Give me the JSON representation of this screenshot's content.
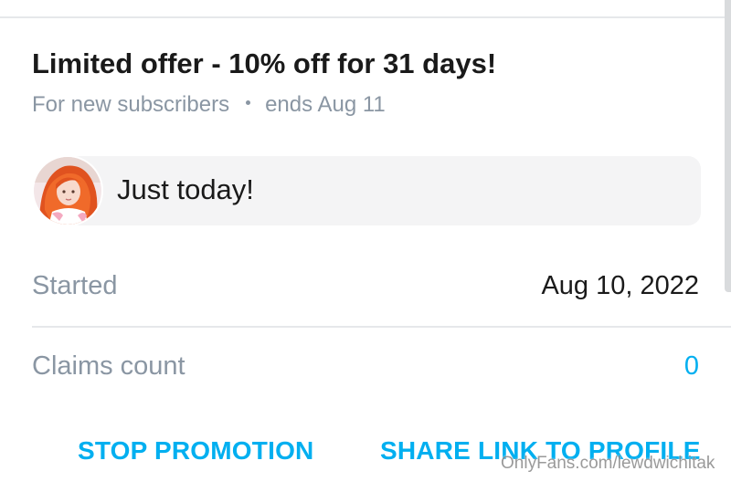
{
  "promotion": {
    "title": "Limited offer - 10% off for 31 days!",
    "audience": "For new subscribers",
    "ends": "ends Aug 11"
  },
  "message": {
    "text": "Just today!",
    "avatar_icon": "avatar-photo"
  },
  "details": {
    "started_label": "Started",
    "started_value": "Aug 10, 2022",
    "claims_label": "Claims count",
    "claims_value": "0"
  },
  "actions": {
    "stop_label": "STOP PROMOTION",
    "share_label": "SHARE LINK TO PROFILE"
  },
  "watermark": "OnlyFans.com/lewdwichitak",
  "colors": {
    "accent": "#00aff0",
    "muted_text": "#8a96a3",
    "primary_text": "#1a1a1a",
    "bubble_bg": "#f4f4f5",
    "divider": "#e6e8ea"
  }
}
